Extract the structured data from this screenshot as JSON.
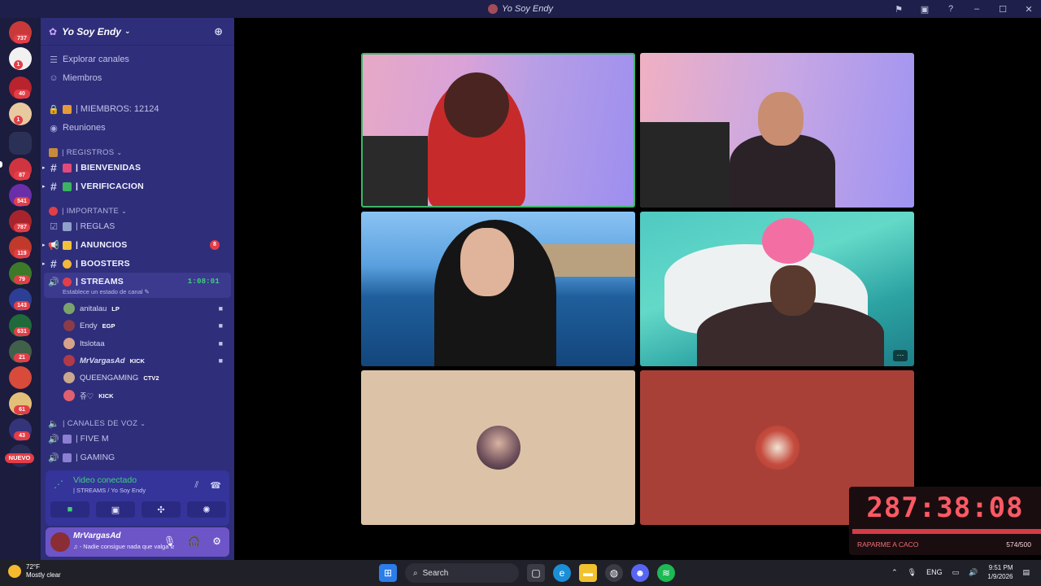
{
  "window": {
    "title": "Yo Soy Endy"
  },
  "rail": {
    "badges": [
      "737",
      "1",
      "40",
      "1",
      "87",
      "541",
      "787",
      "119",
      "79",
      "143",
      "631",
      "21",
      "61",
      "43"
    ],
    "new_label": "NUEVO"
  },
  "server": {
    "name": "Yo Soy Endy",
    "top_items": [
      {
        "label": "Explorar canales",
        "icon": "browse-icon"
      },
      {
        "label": "Miembros",
        "icon": "members-icon"
      }
    ],
    "members_label": "| MIEMBROS: 12124",
    "meetings_label": "Reuniones",
    "categories": {
      "registros": "| REGISTROS",
      "importante": "| IMPORTANTE",
      "voz": "| CANALES DE VOZ"
    },
    "channels": {
      "bienvenidas": "| BIENVENIDAS",
      "verificacion": "| VERIFICACION",
      "reglas": "| REGLAS",
      "anuncios": "| ANUNCIOS",
      "anuncios_badge": "8",
      "boosters": "| BOOSTERS",
      "streams": "| STREAMS",
      "streams_time": "1:08:01",
      "streams_status": "Establece un estado de canal",
      "fivem": "| FIVE M",
      "gaming": "| GAMING"
    },
    "voice_members": [
      {
        "name": "anitalau",
        "tag": "LP",
        "color": "#7aa36c"
      },
      {
        "name": "Endy",
        "tag": "EGP",
        "color": "#8a3c4a"
      },
      {
        "name": "Itslotaa",
        "tag": "",
        "color": "#d6a38a"
      },
      {
        "name": "MrVargasAd",
        "tag": "KICK",
        "color": "#b03a48"
      },
      {
        "name": "QUEENGAMING",
        "tag": "CTV2",
        "color": "#c9a88e"
      },
      {
        "name": "쥬♡",
        "tag": "KICK",
        "color": "#e06070"
      }
    ]
  },
  "voice_panel": {
    "status": "Video conectado",
    "channel": "| STREAMS / Yo Soy Endy"
  },
  "user_panel": {
    "name": "MrVargasAd",
    "status": "♫ - Nadie consigue nada que valga la p..."
  },
  "timer": {
    "time": "287:38:08",
    "label": "RAPARME A CACO",
    "count": "574/500"
  },
  "taskbar": {
    "temp": "72°F",
    "weather": "Mostly clear",
    "search": "Search",
    "lang": "ENG",
    "time": "9:51 PM",
    "date": "1/9/2026"
  },
  "colors": {
    "sidebar": "#2f2e7a",
    "rail": "#1b1c3e",
    "connected": "#3fd07a",
    "timer_red": "#ff5964"
  }
}
